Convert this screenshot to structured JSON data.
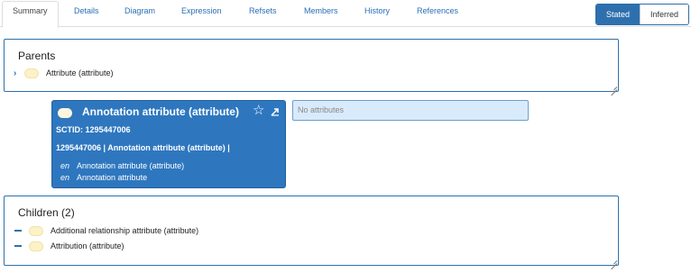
{
  "tabs": [
    {
      "label": "Summary",
      "active": true
    },
    {
      "label": "Details"
    },
    {
      "label": "Diagram"
    },
    {
      "label": "Expression"
    },
    {
      "label": "Refsets"
    },
    {
      "label": "Members"
    },
    {
      "label": "History"
    },
    {
      "label": "References"
    }
  ],
  "view_toggle": {
    "stated": "Stated",
    "inferred": "Inferred",
    "selected": "Stated"
  },
  "parents": {
    "title": "Parents",
    "items": [
      {
        "label": "Attribute (attribute)"
      }
    ]
  },
  "concept": {
    "title": "Annotation attribute (attribute)",
    "sctid_line": "SCTID: 1295447006",
    "fsn_line": "1295447006 | Annotation attribute (attribute) |",
    "descriptions": [
      {
        "lang": "en",
        "term": "Annotation attribute (attribute)"
      },
      {
        "lang": "en",
        "term": "Annotation attribute"
      }
    ]
  },
  "attributes": {
    "empty_text": "No attributes"
  },
  "children": {
    "title": "Children (2)",
    "items": [
      {
        "label": "Additional relationship attribute (attribute)"
      },
      {
        "label": "Attribution (attribute)"
      }
    ]
  },
  "colors": {
    "accent": "#2e70ad",
    "card": "#2e77bf",
    "concept_pill": "#fdf1c7"
  }
}
